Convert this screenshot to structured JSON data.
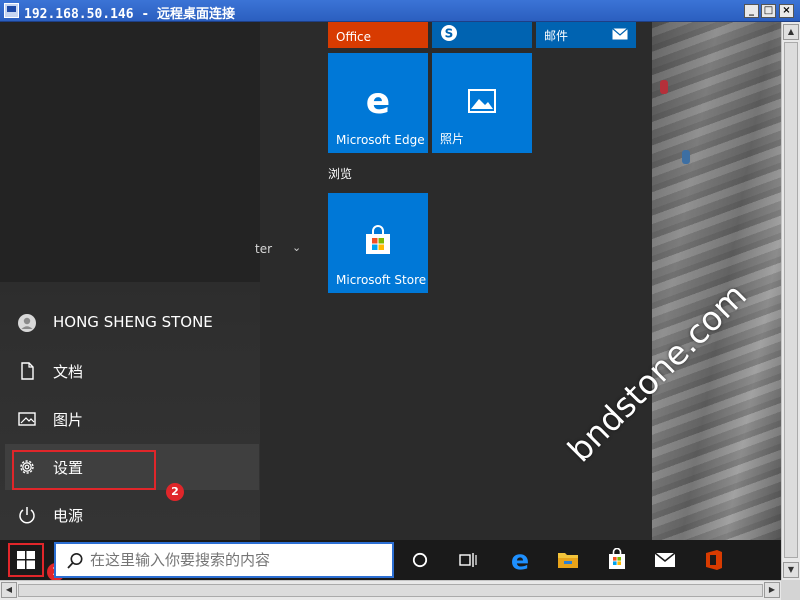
{
  "window": {
    "title": "192.168.50.146 - 远程桌面连接",
    "minimize_glyph": "_",
    "maximize_glyph": "□",
    "close_glyph": "×"
  },
  "start_menu": {
    "applist_truncated_text": "ter",
    "user_name": "HONG SHENG STONE",
    "rail": {
      "documents": "文档",
      "pictures": "图片",
      "settings": "设置",
      "power": "电源"
    },
    "tiles": {
      "office": "Office",
      "mail": "邮件",
      "edge": "Microsoft Edge",
      "photos": "照片",
      "store": "Microsoft Store"
    },
    "section_browse": "浏览"
  },
  "taskbar": {
    "search_placeholder": "在这里输入你要搜索的内容"
  },
  "annotations": {
    "badge_1": "1",
    "badge_2": "2"
  },
  "watermark": "bndstone.com",
  "colors": {
    "accent_blue": "#0063b1",
    "office_orange": "#d83b01",
    "highlight_red": "#e0262a",
    "titlebar_blue": "#2b5fbf"
  }
}
